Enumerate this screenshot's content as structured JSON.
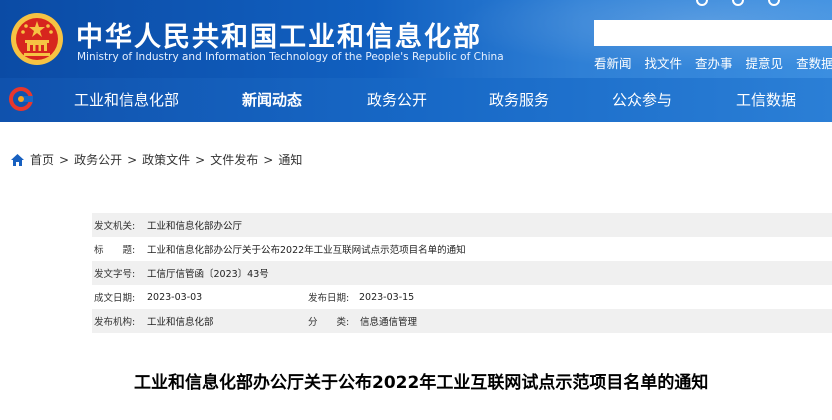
{
  "header": {
    "title": "中华人民共和国工业和信息化部",
    "subtitle": "Ministry of Industry and Information Technology of the People's Republic of China",
    "search_placeholder": "",
    "quick_links": [
      "看新闻",
      "找文件",
      "查办事",
      "提意见",
      "查数据"
    ]
  },
  "nav": {
    "items": [
      "工业和信息化部",
      "新闻动态",
      "政务公开",
      "政务服务",
      "公众参与",
      "工信数据"
    ],
    "active": "新闻动态"
  },
  "breadcrumb": [
    "首页",
    "政务公开",
    "政策文件",
    "文件发布",
    "通知"
  ],
  "info": {
    "issuer_label": "发文机关:",
    "issuer": "工业和信息化部办公厅",
    "title_label": "标　　题:",
    "title": "工业和信息化部办公厅关于公布2022年工业互联网试点示范项目名单的通知",
    "docno_label": "发文字号:",
    "docno": "工信厅信管函〔2023〕43号",
    "created_label": "成文日期:",
    "created": "2023-03-03",
    "published_label": "发布日期:",
    "published": "2023-03-15",
    "agency_label": "发布机构:",
    "agency": "工业和信息化部",
    "category_label": "分　　类:",
    "category": "信息通信管理"
  },
  "doc_title": "工业和信息化部办公厅关于公布2022年工业互联网试点示范项目名单的通知",
  "colors": {
    "header_blue": "#1160c0",
    "nav_blue": "#1768c6",
    "emblem_red": "#d7261e",
    "emblem_gold": "#f6c343"
  },
  "icons": [
    "national-emblem-icon",
    "site-logo-icon",
    "home-icon"
  ]
}
